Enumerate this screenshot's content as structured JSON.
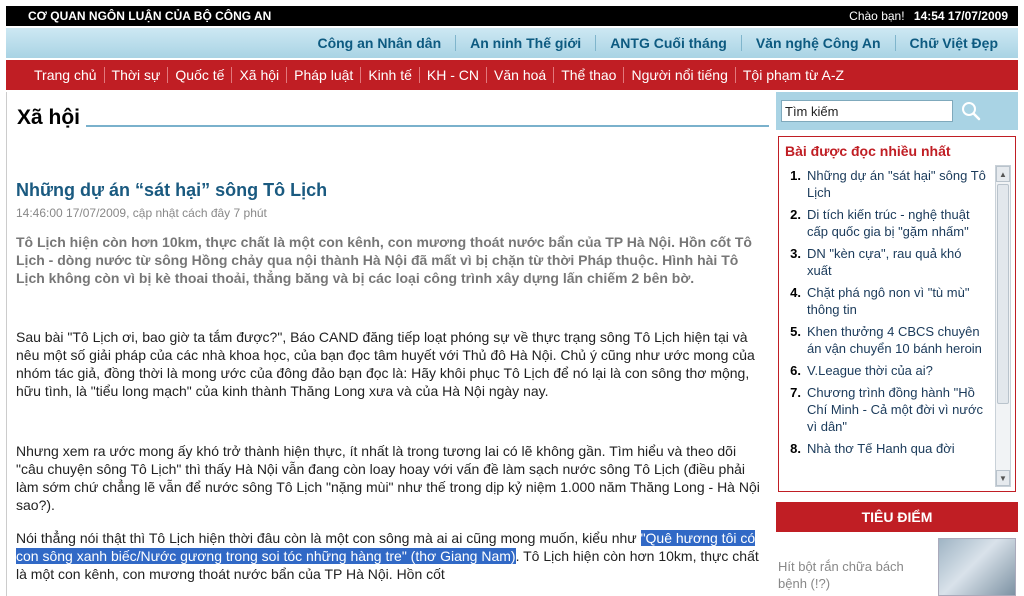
{
  "topbar": {
    "site_label": "CƠ QUAN NGÔN LUẬN CỦA BỘ CÔNG AN",
    "greeting": "Chào bạn!",
    "datetime": "14:54 17/07/2009"
  },
  "publications": [
    "Công an Nhân dân",
    "An ninh Thế giới",
    "ANTG Cuối tháng",
    "Văn nghệ Công An",
    "Chữ Việt Đẹp"
  ],
  "nav": [
    "Trang chủ",
    "Thời sự",
    "Quốc tế",
    "Xã hội",
    "Pháp luật",
    "Kinh tế",
    "KH - CN",
    "Văn hoá",
    "Thể thao",
    "Người nổi tiếng",
    "Tội phạm từ A-Z"
  ],
  "section": {
    "title": "Xã hội"
  },
  "article": {
    "title": "Những dự án “sát hại” sông Tô Lịch",
    "time": "14:46:00 17/07/2009, cập nhật cách đây 7 phút",
    "lead": "Tô Lịch hiện còn hơn 10km, thực chất là một con kênh, con mương thoát nước bẩn của TP Hà Nội. Hồn cốt Tô Lịch - dòng nước từ sông Hồng chảy qua nội thành Hà Nội đã mất vì bị chặn từ thời Pháp thuộc. Hình hài Tô Lịch không còn vì bị kè thoai thoải, thẳng băng và bị các loại công trình xây dựng lấn chiếm 2 bên bờ.",
    "p1": "Sau bài \"Tô Lịch ơi, bao giờ ta tắm được?\", Báo CAND đăng tiếp loạt phóng sự về thực trạng sông Tô Lịch hiện tại và nêu một số giải pháp của các nhà khoa học, của bạn đọc tâm huyết với Thủ đô Hà Nội. Chủ ý cũng như ước mong của nhóm tác giả, đồng thời là mong ước của đông đảo bạn đọc là: Hãy khôi phục Tô Lịch để nó lại là con sông thơ mộng, hữu tình, là \"tiểu long mạch\" của kinh thành Thăng Long xưa và của Hà Nội ngày nay.",
    "p2": "Nhưng xem ra ước mong ấy khó trở thành hiện thực, ít nhất là trong tương lai có lẽ không gần. Tìm hiểu và theo dõi \"câu chuyện sông Tô Lịch\" thì thấy Hà Nội vẫn đang còn loay hoay với vấn đề làm sạch nước sông Tô Lịch (điều phải làm sớm chứ chẳng lẽ vẫn để nước sông Tô Lịch \"nặng mùi\" như thế trong dịp kỷ niệm 1.000 năm Thăng Long - Hà Nội sao?).",
    "p3_before": "Nói thẳng nói thật thì Tô Lịch hiện thời đâu còn là một con sông mà ai ai cũng mong muốn, kiểu như ",
    "p3_highlight": "\"Quê hương tôi có con sông xanh biếc/Nước gương trong soi tóc những hàng tre\" (thơ Giang Nam)",
    "p3_after": ". Tô Lịch hiện còn hơn 10km, thực chất là một con kênh, con mương thoát nước bẩn của TP Hà Nội. Hồn cốt"
  },
  "sidebar": {
    "search_value": "Tìm kiếm",
    "search_icon": "magnifier",
    "popular_title": "Bài được đọc nhiều nhất",
    "popular": [
      {
        "num": "1.",
        "text": "Những dự án \"sát hại\" sông Tô Lịch"
      },
      {
        "num": "2.",
        "text": "Di tích kiến trúc - nghệ thuật cấp quốc gia bị \"gặm nhấm\""
      },
      {
        "num": "3.",
        "text": "DN \"kèn cựa\", rau quả khó xuất"
      },
      {
        "num": "4.",
        "text": "Chặt phá ngô non vì \"tù mù\" thông tin"
      },
      {
        "num": "5.",
        "text": "Khen thưởng 4 CBCS chuyên án vận chuyển 10 bánh heroin"
      },
      {
        "num": "6.",
        "text": "V.League thời của ai?"
      },
      {
        "num": "7.",
        "text": "Chương trình đồng hành \"Hồ Chí Minh - Cả một đời vì nước vì dân\""
      },
      {
        "num": "8.",
        "text": "Nhà thơ Tế Hanh qua đời"
      }
    ],
    "focus_title": "TIÊU ĐIỂM",
    "focus_text": "Hít bột rắn chữa bách bệnh (!?)"
  },
  "colors": {
    "red": "#c01e24",
    "blue": "#a9d3e4",
    "link": "#1a5a80"
  }
}
